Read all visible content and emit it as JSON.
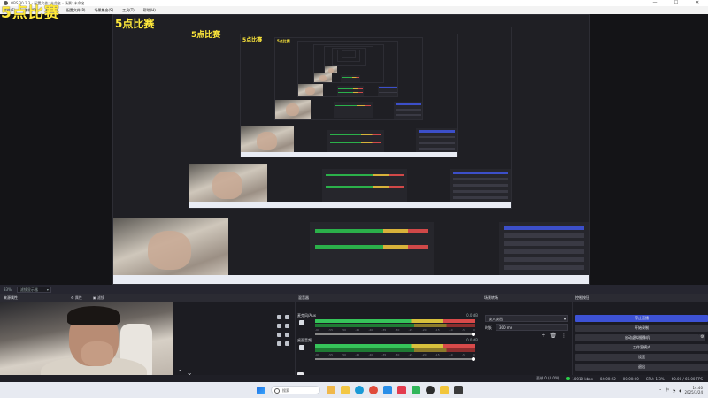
{
  "overlay": {
    "text": "5点比赛"
  },
  "window": {
    "title": "OBS 30.2.3 - 配置文件: 未命名 - 场景: 未命名",
    "minimize": "—",
    "maximize": "☐",
    "close": "✕"
  },
  "menu": [
    "文件(F)",
    "编辑(E)",
    "视图(V)",
    "配置文件(P)",
    "场景集合(S)",
    "工具(T)",
    "帮助(H)"
  ],
  "scene_strip": {
    "collection": "场景",
    "zoom": "33%",
    "filter": "滤镜显示器"
  },
  "docks": {
    "sources_title": "来源属性",
    "properties_btn": "属性",
    "filters_btn": "滤镜",
    "mixer_title": "混音器",
    "transitions_title": "场景转场",
    "controls_title": "控制按钮"
  },
  "mixer": {
    "tracks": [
      {
        "name": "麦克风/Aux",
        "db": "0.0 dB"
      },
      {
        "name": "桌面音频",
        "db": "0.0 dB"
      }
    ],
    "ticks": [
      "-60",
      "-55",
      "-50",
      "-45",
      "-40",
      "-35",
      "-30",
      "-25",
      "-20",
      "-15",
      "-10",
      "-5",
      "0"
    ]
  },
  "transition": {
    "type": "淡入淡出",
    "duration_label": "时长",
    "duration": "300 ms",
    "add": "+",
    "remove": "🗑",
    "more": "⋮"
  },
  "controls": {
    "stop_stream": "停止直播",
    "start_record": "开始录制",
    "virtual_camera": "启动虚拟摄像机",
    "studio_mode": "工作室模式",
    "settings": "设置",
    "exit": "退出"
  },
  "status": {
    "dropped": "丢帧 0 (0.0%)",
    "bitrate": "10010 kbps",
    "time": "04:00:22",
    "rec": "00:00:00",
    "cpu": "CPU: 1.3%",
    "fps": "60.00 / 60.00 FPS"
  },
  "taskbar": {
    "search_placeholder": "搜索",
    "clock_time": "14:40",
    "clock_date": "2025/3/24",
    "ime": "中"
  },
  "colors": {
    "accent": "#3d52d5",
    "overlay": "#ffe93b",
    "meter_green": "#36c45a",
    "meter_yellow": "#d8c03c",
    "meter_red": "#d84a4a"
  }
}
